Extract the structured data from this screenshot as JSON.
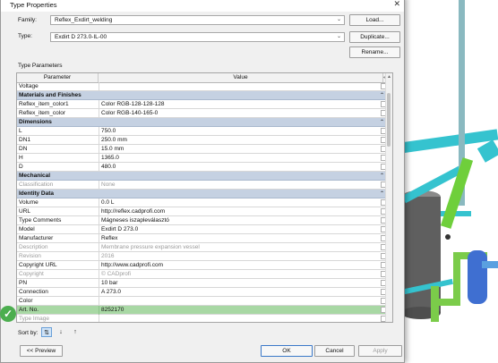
{
  "dialog": {
    "title": "Type Properties",
    "family_label": "Family:",
    "family_value": "Reflex_Exdirt_welding",
    "type_label": "Type:",
    "type_value": "Exdirt D 273.0-IL-00",
    "load_button": "Load...",
    "duplicate_button": "Duplicate...",
    "rename_button": "Rename...",
    "section_label": "Type Parameters"
  },
  "grid": {
    "col_parameter": "Parameter",
    "col_value": "Value",
    "rows": [
      {
        "kind": "item",
        "p": "Voltage",
        "v": "",
        "dim": false
      },
      {
        "kind": "group",
        "p": "Materials and Finishes"
      },
      {
        "kind": "item",
        "p": "Reflex_item_color1",
        "v": "Color RGB-128-128-128",
        "dim": false
      },
      {
        "kind": "item",
        "p": "Reflex_item_color",
        "v": "Color RGB-140-165-0",
        "dim": false
      },
      {
        "kind": "group",
        "p": "Dimensions"
      },
      {
        "kind": "item",
        "p": "L",
        "v": "750.0",
        "dim": false
      },
      {
        "kind": "item",
        "p": "DN1",
        "v": "250.0 mm",
        "dim": false
      },
      {
        "kind": "item",
        "p": "DN",
        "v": "15.0 mm",
        "dim": false
      },
      {
        "kind": "item",
        "p": "H",
        "v": "1365.0",
        "dim": false
      },
      {
        "kind": "item",
        "p": "D",
        "v": "480.0",
        "dim": false
      },
      {
        "kind": "group",
        "p": "Mechanical"
      },
      {
        "kind": "item",
        "p": "Classification",
        "v": "None",
        "dim": true
      },
      {
        "kind": "group",
        "p": "Identity Data"
      },
      {
        "kind": "item",
        "p": "Volume",
        "v": "0.0 L",
        "dim": false
      },
      {
        "kind": "item",
        "p": "URL",
        "v": "http://reflex.cadprofi.com",
        "dim": false
      },
      {
        "kind": "item",
        "p": "Type Comments",
        "v": "Mágneses iszapleválasztó",
        "dim": false
      },
      {
        "kind": "item",
        "p": "Model",
        "v": "Exdirt D 273.0",
        "dim": false
      },
      {
        "kind": "item",
        "p": "Manufacturer",
        "v": "Reflex",
        "dim": false
      },
      {
        "kind": "item",
        "p": "Description",
        "v": "Membrane pressure expansion vessel",
        "dim": true
      },
      {
        "kind": "item",
        "p": "Revision",
        "v": "2016",
        "dim": true
      },
      {
        "kind": "item",
        "p": "Copyright URL",
        "v": "http://www.cadprofi.com",
        "dim": false
      },
      {
        "kind": "item",
        "p": "Copyright",
        "v": "© CADprofi",
        "dim": true
      },
      {
        "kind": "item",
        "p": "PN",
        "v": "10 bar",
        "dim": false
      },
      {
        "kind": "item",
        "p": "Connection",
        "v": "A 273.0",
        "dim": false
      },
      {
        "kind": "item",
        "p": "Color",
        "v": "",
        "dim": false
      },
      {
        "kind": "item",
        "p": "Art. No.",
        "v": "8252170",
        "dim": false,
        "selected": true
      },
      {
        "kind": "item",
        "p": "Type Image",
        "v": "",
        "dim": true
      }
    ]
  },
  "footer": {
    "sort_label": "Sort by:",
    "preview_button": "<< Preview",
    "ok_button": "OK",
    "cancel_button": "Cancel",
    "apply_button": "Apply"
  },
  "colors": {
    "group_header": "#c5d1e2",
    "selected_row": "#a8d8a4",
    "pipe_cyan": "#35c3cf",
    "pipe_green": "#7bcc4a",
    "vessel_blue": "#3f6fd1",
    "tank_gray": "#6b6b6b"
  }
}
